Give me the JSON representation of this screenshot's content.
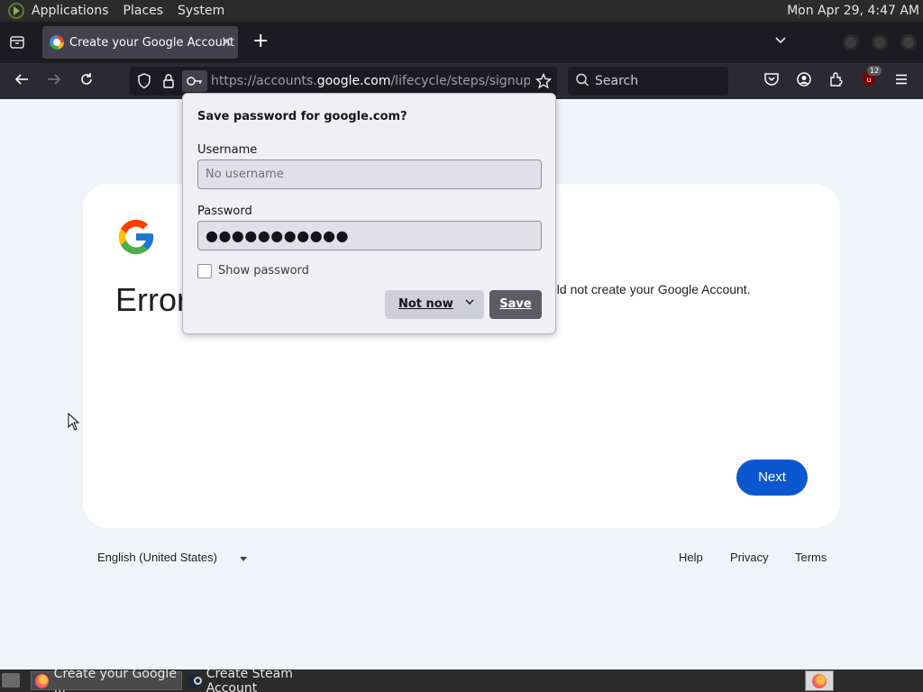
{
  "top_panel": {
    "menu": [
      "Applications",
      "Places",
      "System"
    ],
    "clock": "Mon Apr 29,  4:47 AM"
  },
  "browser": {
    "tab": {
      "title": "Create your Google Account"
    },
    "url": {
      "prefix": "https://accounts.",
      "domain": "google.com",
      "path": "/lifecycle/steps/signup/error"
    },
    "search_placeholder": "Search",
    "ublock_badge": "12"
  },
  "page": {
    "error_title": "Error",
    "error_message": "uld not create your Google Account.",
    "next_button": "Next",
    "footer": {
      "language": "English (United States)",
      "links": [
        "Help",
        "Privacy",
        "Terms"
      ]
    }
  },
  "save_password_popup": {
    "title": "Save password for google.com?",
    "username_label": "Username",
    "username_placeholder": "No username",
    "password_label": "Password",
    "password_value": "●●●●●●●●●●●",
    "show_password_label": "Show password",
    "not_now_label": "Not now",
    "save_label": "Save"
  },
  "taskbar": {
    "tasks": [
      "Create your Google ...",
      "Create Steam Account"
    ]
  },
  "colors": {
    "next_button": "#0b57d0",
    "page_background": "#f0f4f9",
    "browser_chrome": "#2b2a33"
  }
}
